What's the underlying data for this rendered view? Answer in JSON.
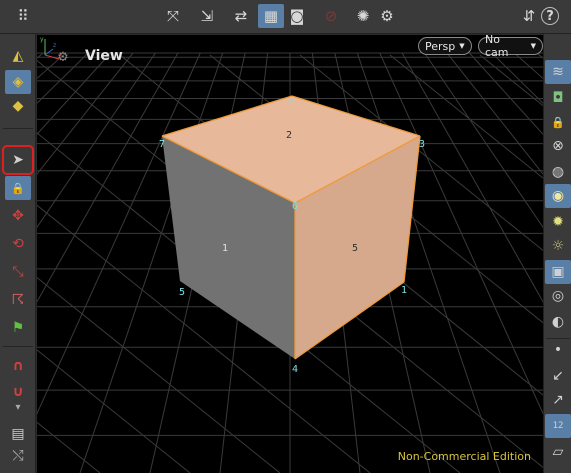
{
  "topbar": {
    "buttons": [
      {
        "name": "grid-menu-icon",
        "glyph": "⠿"
      },
      {
        "name": "transform-handle-icon",
        "glyph": "⤧"
      },
      {
        "name": "snap-icon",
        "glyph": "⇲"
      },
      {
        "name": "align-icon",
        "glyph": "⇄"
      },
      {
        "name": "viewport-layout-icon",
        "glyph": "▦"
      },
      {
        "name": "camera-view-icon",
        "glyph": "◙"
      },
      {
        "name": "stop-render-icon",
        "glyph": "⊘"
      },
      {
        "name": "light-link-icon",
        "glyph": "✺"
      },
      {
        "name": "settings-gear-icon",
        "glyph": "⚙"
      },
      {
        "name": "flipbook-icon",
        "glyph": "⇵"
      },
      {
        "name": "help-icon",
        "glyph": "?"
      }
    ]
  },
  "left_toolbar": {
    "buttons": [
      {
        "name": "select-geometry-icon",
        "glyph": "◭"
      },
      {
        "name": "select-points-icon",
        "glyph": "◈"
      },
      {
        "name": "select-primitives-icon",
        "glyph": "◆"
      },
      {
        "name": "select-tool-icon",
        "glyph": "➤"
      },
      {
        "name": "lock-tool-icon",
        "glyph": "🔒"
      },
      {
        "name": "move-tool-icon",
        "glyph": "✥"
      },
      {
        "name": "rotate-tool-icon",
        "glyph": "⟲"
      },
      {
        "name": "scale-tool-icon",
        "glyph": "⤡"
      },
      {
        "name": "pose-tool-icon",
        "glyph": "☈"
      },
      {
        "name": "handle-tool-icon",
        "glyph": "⚑"
      },
      {
        "name": "magnet-snap-icon",
        "glyph": "∩"
      },
      {
        "name": "magnet-options-icon",
        "glyph": "∪"
      },
      {
        "name": "more-arrow-icon",
        "glyph": "▾"
      },
      {
        "name": "render-region-icon",
        "glyph": "▤"
      },
      {
        "name": "view-gizmo-icon",
        "glyph": "⤭"
      }
    ]
  },
  "right_toolbar": {
    "buttons": [
      {
        "name": "display-options-icon",
        "glyph": "≋"
      },
      {
        "name": "ghost-other-objects-icon",
        "glyph": "◘"
      },
      {
        "name": "lock-camera-icon",
        "glyph": "🔒"
      },
      {
        "name": "close-view-icon",
        "glyph": "⊗"
      },
      {
        "name": "display-points-icon",
        "glyph": "◍"
      },
      {
        "name": "headlight-icon",
        "glyph": "◉"
      },
      {
        "name": "light-bulb-icon",
        "glyph": "✹"
      },
      {
        "name": "light-off-icon",
        "glyph": "☼"
      },
      {
        "name": "background-icon",
        "glyph": "▣"
      },
      {
        "name": "visibility-eye-icon",
        "glyph": "◎"
      },
      {
        "name": "template-icon",
        "glyph": "◐"
      },
      {
        "name": "point-display-icon",
        "glyph": "•"
      },
      {
        "name": "normal-display-icon",
        "glyph": "↙"
      },
      {
        "name": "vector-display-icon",
        "glyph": "↗"
      },
      {
        "name": "numbers-display-icon",
        "glyph": "12"
      },
      {
        "name": "ground-grid-icon",
        "glyph": "▱"
      }
    ]
  },
  "viewport": {
    "title": "View",
    "persp_dropdown": "Persp",
    "cam_dropdown": "No cam",
    "watermark": "Non-Commercial Edition",
    "colors": {
      "background": "#000000",
      "grid": "#3a3a3a",
      "cube_left": "#727272",
      "cube_top": "#e7b89a",
      "cube_front": "#d6a98d",
      "edge_highlight": "#ee9a3a",
      "point_label": "#7fe0e0"
    },
    "point_labels": [
      "2",
      "7",
      "3",
      "6",
      "5",
      "1",
      "4"
    ],
    "face_labels": [
      "2",
      "1",
      "5"
    ]
  }
}
